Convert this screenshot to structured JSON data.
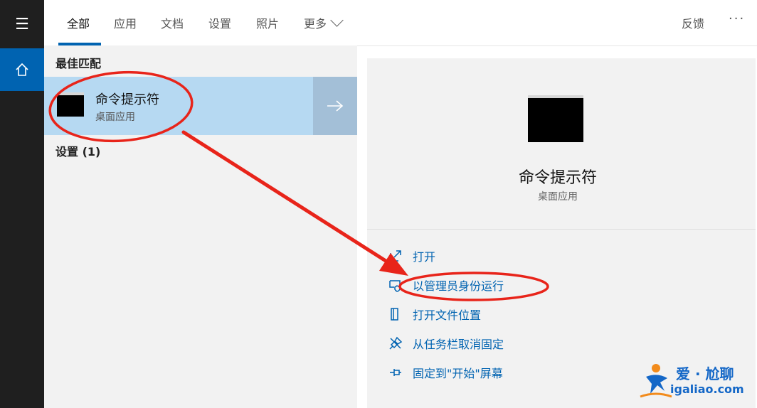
{
  "tabs": [
    {
      "label": "全部",
      "active": true
    },
    {
      "label": "应用"
    },
    {
      "label": "文档"
    },
    {
      "label": "设置"
    },
    {
      "label": "照片"
    },
    {
      "label": "更多"
    }
  ],
  "header": {
    "feedback": "反馈",
    "more_menu": "···"
  },
  "left": {
    "best_match_header": "最佳匹配",
    "best_match": {
      "title": "命令提示符",
      "subtitle": "桌面应用"
    },
    "settings_header": "设置 (1)"
  },
  "detail": {
    "name": "命令提示符",
    "subtitle": "桌面应用",
    "actions": [
      {
        "label": "打开",
        "icon": "open-icon"
      },
      {
        "label": "以管理员身份运行",
        "icon": "shield-admin-icon"
      },
      {
        "label": "打开文件位置",
        "icon": "file-location-icon"
      },
      {
        "label": "从任务栏取消固定",
        "icon": "unpin-icon"
      },
      {
        "label": "固定到\"开始\"屏幕",
        "icon": "pin-icon"
      }
    ]
  },
  "watermark": {
    "title": "爱 · 尬聊",
    "url": "igaliao.com"
  },
  "colors": {
    "accent": "#0063b1",
    "selected": "#b6d9f2",
    "annotation": "#e8241a"
  }
}
